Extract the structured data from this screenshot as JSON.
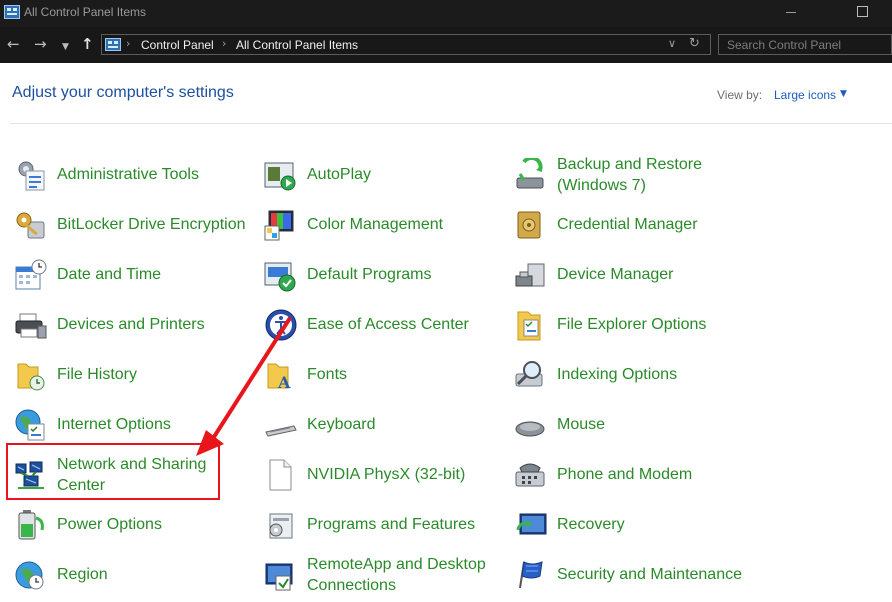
{
  "window": {
    "title": "All Control Panel Items"
  },
  "address_bar": {
    "crumbs": [
      "Control Panel",
      "All Control Panel Items"
    ],
    "search_placeholder": "Search Control Panel"
  },
  "header": {
    "title": "Adjust your computer's settings",
    "view_by_label": "View by:",
    "view_mode": "Large icons"
  },
  "items": {
    "administrative_tools": "Administrative Tools",
    "autoplay": "AutoPlay",
    "backup_restore_1": "Backup and Restore",
    "backup_restore_2": "(Windows 7)",
    "bitlocker": "BitLocker Drive Encryption",
    "color_management": "Color Management",
    "credential_manager": "Credential Manager",
    "date_time": "Date and Time",
    "default_programs": "Default Programs",
    "device_manager": "Device Manager",
    "devices_printers": "Devices and Printers",
    "ease_of_access": "Ease of Access Center",
    "file_explorer_options": "File Explorer Options",
    "file_history": "File History",
    "fonts": "Fonts",
    "indexing_options": "Indexing Options",
    "internet_options": "Internet Options",
    "keyboard": "Keyboard",
    "mouse": "Mouse",
    "network_sharing_1": "Network and Sharing",
    "network_sharing_2": "Center",
    "nvidia_physx": "NVIDIA PhysX (32-bit)",
    "phone_modem": "Phone and Modem",
    "power_options": "Power Options",
    "programs_features": "Programs and Features",
    "recovery": "Recovery",
    "region": "Region",
    "remoteapp_1": "RemoteApp and Desktop",
    "remoteapp_2": "Connections",
    "security_maintenance": "Security and Maintenance"
  },
  "colors": {
    "item_text": "#2a8a2a",
    "heading": "#1e4fa0",
    "highlight": "#e8151a",
    "titlebar": "#1b1b1b"
  }
}
